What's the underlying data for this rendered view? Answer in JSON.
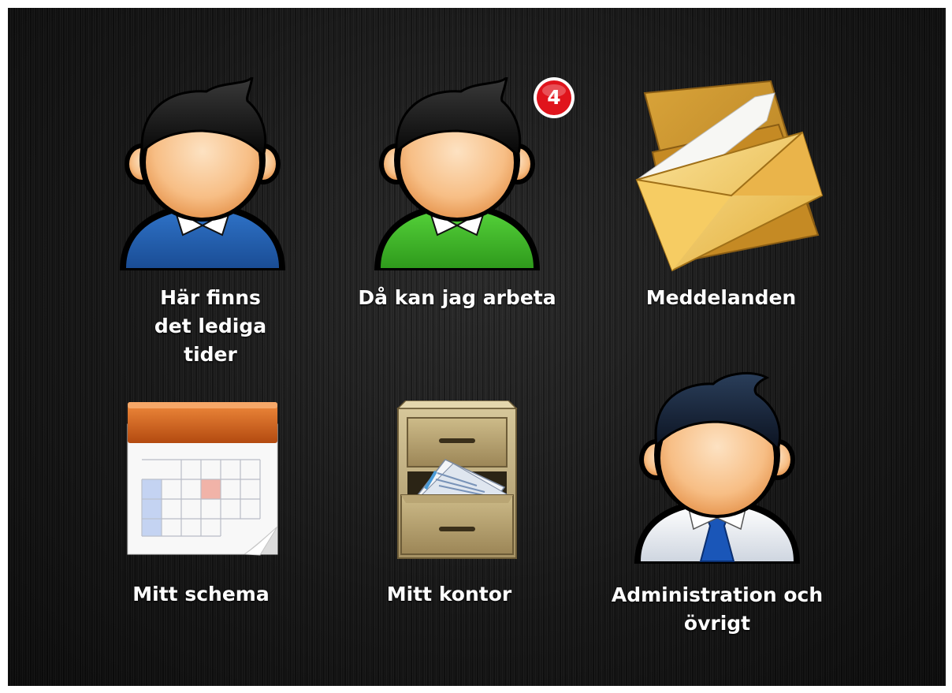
{
  "menu": {
    "tiles": [
      {
        "label": "Här finns det lediga tider",
        "icon": "user-blue-shirt-icon"
      },
      {
        "label": "Då kan jag arbeta",
        "icon": "user-green-shirt-icon",
        "badge": "4"
      },
      {
        "label": "Meddelanden",
        "icon": "envelope-icon"
      },
      {
        "label": "Mitt schema",
        "icon": "calendar-icon"
      },
      {
        "label": "Mitt kontor",
        "icon": "file-cabinet-icon"
      },
      {
        "label": "Administration och övrigt",
        "icon": "user-admin-tie-icon"
      }
    ]
  },
  "colors": {
    "background": "#141414",
    "badge": "#e0141c",
    "shirt_blue": "#1e5aa8",
    "shirt_green": "#3fb82c",
    "tie": "#1a56b8"
  }
}
